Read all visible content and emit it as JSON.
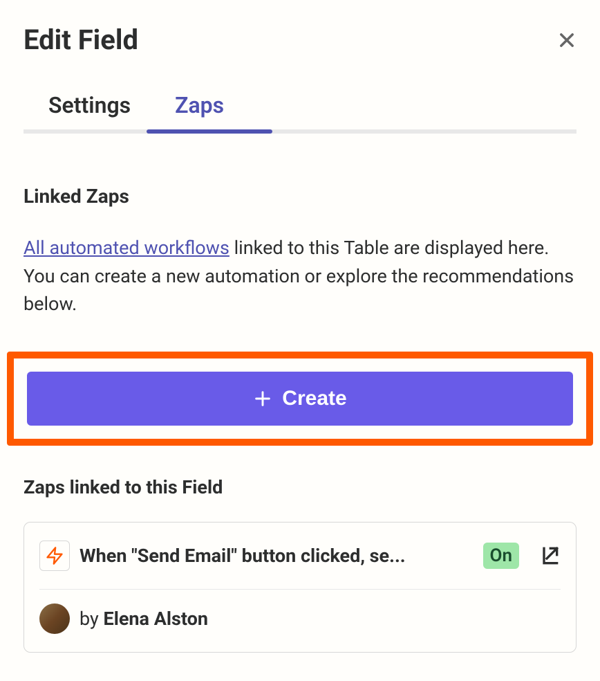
{
  "header": {
    "title": "Edit Field"
  },
  "tabs": [
    {
      "label": "Settings",
      "active": false
    },
    {
      "label": "Zaps",
      "active": true
    }
  ],
  "section": {
    "heading": "Linked Zaps",
    "link_text": "All automated workflows",
    "description_rest": " linked to this Table are displayed here. You can create a new automation or explore the recommendations below."
  },
  "create_button": {
    "label": "Create"
  },
  "subsection": {
    "heading": "Zaps linked to this Field"
  },
  "zap": {
    "title": "When \"Send Email\" button clicked, se...",
    "status": "On",
    "author_prefix": "by ",
    "author_name": "Elena Alston"
  }
}
